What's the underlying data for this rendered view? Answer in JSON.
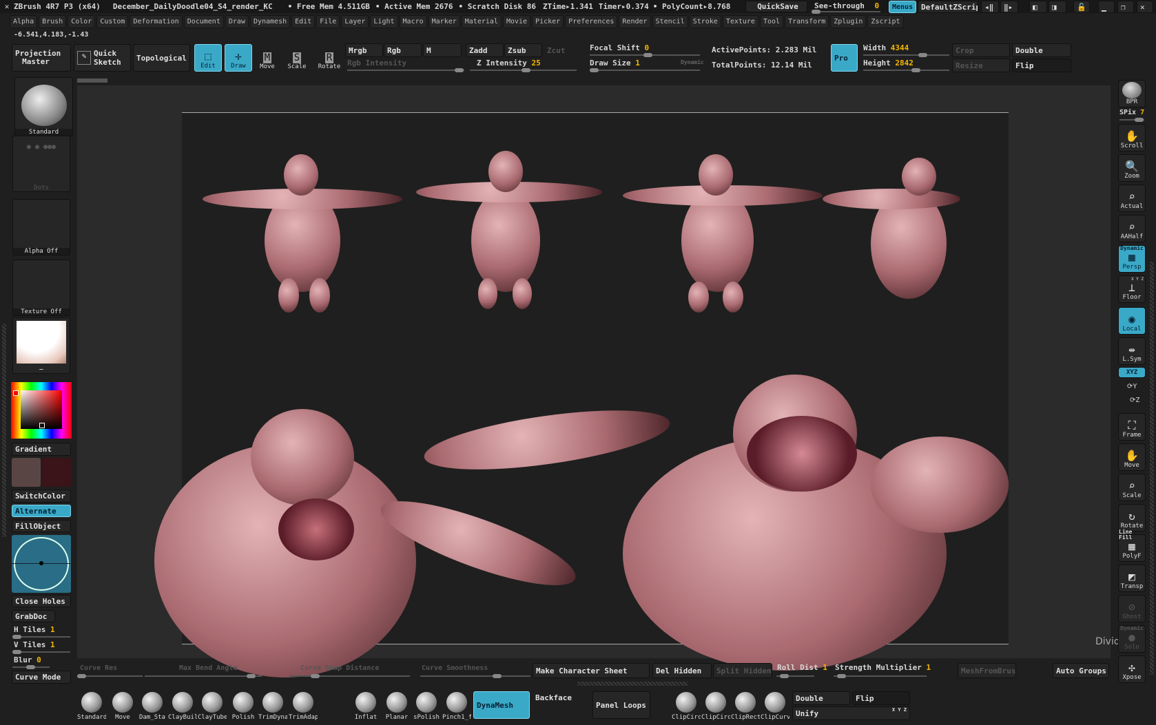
{
  "titlebar": {
    "app": "ZBrush 4R7 P3 (x64)",
    "document": "December_DailyDoodle04_S4_render_KC",
    "free_mem": "• Free Mem 4.511GB",
    "active_mem": "• Active Mem 2676",
    "scratch": "• Scratch Disk 86",
    "ztime": "ZTime▸1.341",
    "timer": "Timer▸0.374",
    "polycount": "• PolyCount▸8.768",
    "quicksave": "QuickSave",
    "seethrough_label": "See-through",
    "seethrough_value": "0",
    "menus": "Menus",
    "script": "DefaultZScript"
  },
  "menus": [
    "Alpha",
    "Brush",
    "Color",
    "Custom",
    "Deformation",
    "Document",
    "Draw",
    "Dynamesh",
    "Edit",
    "File",
    "Layer",
    "Light",
    "Macro",
    "Marker",
    "Material",
    "Movie",
    "Picker",
    "Preferences",
    "Render",
    "Stencil",
    "Stroke",
    "Texture",
    "Tool",
    "Transform",
    "Zplugin",
    "Zscript"
  ],
  "coords": "-6.541,4.183,-1.43",
  "toolbar": {
    "projection_master": "Projection Master",
    "quick_sketch": "Quick Sketch",
    "topological": "Topological",
    "edit": "Edit",
    "draw": "Draw",
    "move": "Move",
    "scale": "Scale",
    "rotate": "Rotate",
    "mrgb": "Mrgb",
    "rgb": "Rgb",
    "m": "M",
    "zadd": "Zadd",
    "zsub": "Zsub",
    "zcut": "Zcut",
    "rgb_intensity": "Rgb Intensity",
    "z_intensity_label": "Z Intensity",
    "z_intensity": "25",
    "focal_shift_label": "Focal Shift",
    "focal_shift": "0",
    "draw_size_label": "Draw Size",
    "draw_size": "1",
    "dynamic": "Dynamic",
    "active_points": "ActivePoints: 2.283 Mil",
    "total_points": "TotalPoints: 12.14 Mil",
    "pro": "Pro",
    "width_label": "Width",
    "width": "4344",
    "height_label": "Height",
    "height": "2842",
    "crop": "Crop",
    "resize": "Resize",
    "double": "Double",
    "flip": "Flip"
  },
  "left": {
    "brush": "Standard",
    "stroke": "Dots",
    "alpha": "Alpha Off",
    "texture": "Texture Off",
    "material": "_",
    "gradient": "Gradient",
    "main_color": "#5a4545",
    "secondary_color": "#3a1418",
    "switch_color": "SwitchColor",
    "alternate": "Alternate",
    "fill_object": "FillObject",
    "close_holes": "Close Holes",
    "grabdoc": "GrabDoc",
    "h_tiles_label": "H Tiles",
    "h_tiles": "1",
    "v_tiles_label": "V Tiles",
    "v_tiles": "1",
    "blur_label": "Blur",
    "blur": "0",
    "curve_mode": "Curve Mode"
  },
  "right": {
    "bpr": "BPR",
    "spix_label": "SPix",
    "spix": "7",
    "items": [
      {
        "label": "Scroll",
        "icon": "hand-icon",
        "state": "normal"
      },
      {
        "label": "Zoom",
        "icon": "zoom-icon",
        "state": "normal"
      },
      {
        "label": "Actual",
        "icon": "actual-size-icon",
        "state": "normal"
      },
      {
        "label": "AAHalf",
        "icon": "aahalf-icon",
        "state": "normal"
      },
      {
        "label": "Persp",
        "top": "Dynamic",
        "icon": "perspective-icon",
        "state": "on"
      },
      {
        "label": "Floor",
        "icon": "floor-icon",
        "state": "normal"
      },
      {
        "label": "Local",
        "icon": "local-icon",
        "state": "on"
      },
      {
        "label": "L.Sym",
        "icon": "local-symmetry-icon",
        "state": "normal"
      },
      {
        "label": "Frame",
        "icon": "frame-icon",
        "state": "normal"
      },
      {
        "label": "Move",
        "icon": "move-icon",
        "state": "normal"
      },
      {
        "label": "Scale",
        "icon": "scale-icon",
        "state": "normal"
      },
      {
        "label": "Rotate",
        "icon": "rotate-icon",
        "state": "normal"
      },
      {
        "label": "PolyF",
        "top": "Line Fill",
        "icon": "polyframe-icon",
        "state": "normal"
      },
      {
        "label": "Transp",
        "icon": "transparency-icon",
        "state": "normal"
      },
      {
        "label": "Ghost",
        "icon": "ghost-icon",
        "state": "dis"
      },
      {
        "label": "Solo",
        "top": "Dynamic",
        "icon": "solo-icon",
        "state": "dis"
      },
      {
        "label": "Xpose",
        "icon": "xpose-icon",
        "state": "normal"
      }
    ],
    "xyz": "XYZ",
    "floor_axes": "X Y Z",
    "tooltip": "Divider"
  },
  "bottom": {
    "curve_res": "Curve Res",
    "max_bend": "Max Bend Angle",
    "snap": "Curve Snap Distance",
    "smooth": "Curve Smoothness",
    "make_sheet": "Make Character Sheet",
    "del_hidden": "Del Hidden",
    "split_hidden": "Split Hidden",
    "roll_dist_label": "Roll Dist",
    "roll_dist": "1",
    "strength_label": "Strength Multiplier",
    "strength": "1",
    "mesh_from_brush": "MeshFromBrus",
    "auto_groups": "Auto Groups",
    "brushes": [
      "Standard",
      "Move",
      "Dam_Sta",
      "ClayBuild",
      "ClayTube",
      "Polish",
      "TrimDyna",
      "TrimAdap",
      "Inflat",
      "Planar",
      "sPolish",
      "Pinch1_f"
    ],
    "dynamesh": "DynaMesh",
    "backface": "BackfaceMask",
    "panel_loops": "Panel Loops",
    "clips": [
      "ClipCircle",
      "ClipCircle",
      "ClipRect",
      "ClipCurve"
    ],
    "double": "Double",
    "flip": "Flip",
    "unify": "Unify",
    "xyz": "X Y Z"
  },
  "colors": {
    "accent": "#3aa9c8",
    "value": "#f5b800"
  }
}
